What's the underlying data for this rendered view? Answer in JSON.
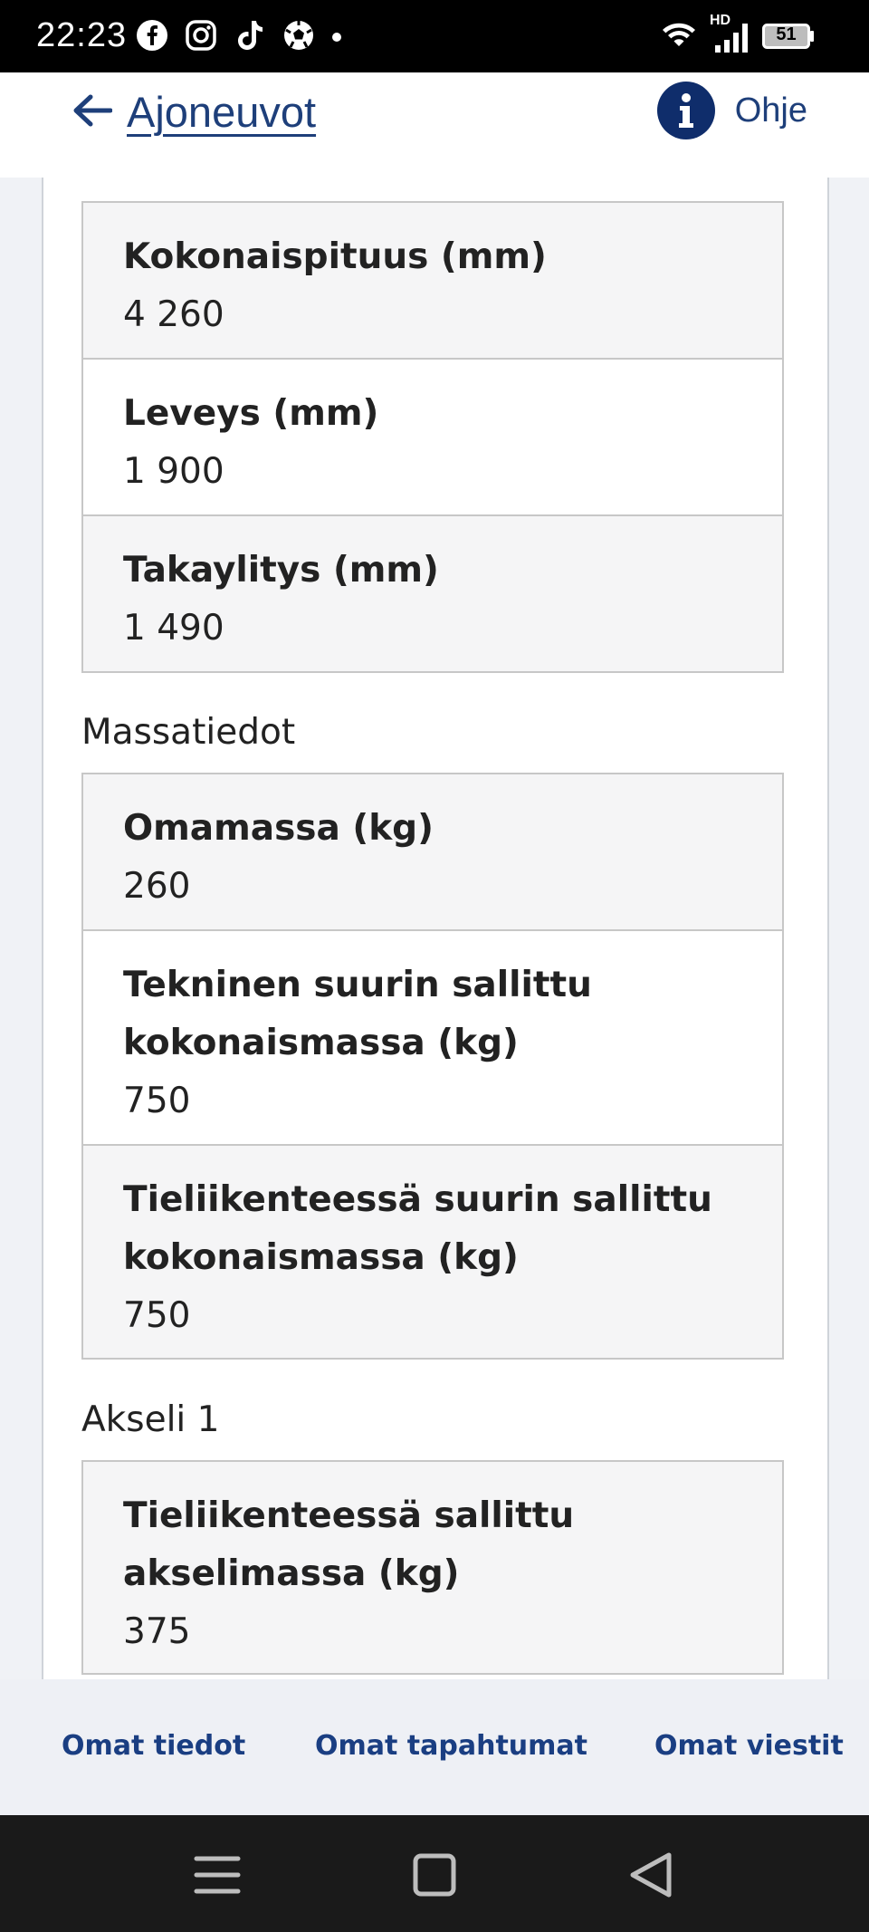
{
  "status_bar": {
    "time": "22:23",
    "network_badge": "HD",
    "battery": "51",
    "icons": [
      "facebook-icon",
      "instagram-icon",
      "tiktok-icon",
      "football-icon",
      "dot-icon",
      "wifi-icon",
      "signal-icon",
      "battery-icon"
    ]
  },
  "header": {
    "back_label": "Ajoneuvot",
    "help_label": "Ohje",
    "accent_color": "#0f2d6b",
    "link_color": "#1e3f7a"
  },
  "dimensions": {
    "rows": [
      {
        "label": "Kokonaispituus (mm)",
        "value": "4 260"
      },
      {
        "label": "Leveys (mm)",
        "value": "1 900"
      },
      {
        "label": "Takaylitys (mm)",
        "value": "1 490"
      }
    ]
  },
  "mass": {
    "title": "Massatiedot",
    "rows": [
      {
        "label": "Omamassa (kg)",
        "value": "260"
      },
      {
        "label_line1": "Tekninen suurin sallittu",
        "label_line2": "kokonaismassa (kg)",
        "value": "750"
      },
      {
        "label_line1": "Tieliikenteessä suurin sallittu",
        "label_line2": "kokonaismassa (kg)",
        "value": "750"
      }
    ]
  },
  "axle": {
    "title": "Akseli 1",
    "rows": [
      {
        "label_line1": "Tieliikenteessä sallittu",
        "label_line2": "akselimassa (kg)",
        "value": "375"
      }
    ]
  },
  "bottom_nav": {
    "items": [
      {
        "label": "Omat tiedot"
      },
      {
        "label": "Omat tapahtumat"
      },
      {
        "label": "Omat viestit"
      }
    ]
  },
  "system_nav": {
    "icons": [
      "menu-icon",
      "home-square-icon",
      "back-triangle-icon"
    ]
  }
}
